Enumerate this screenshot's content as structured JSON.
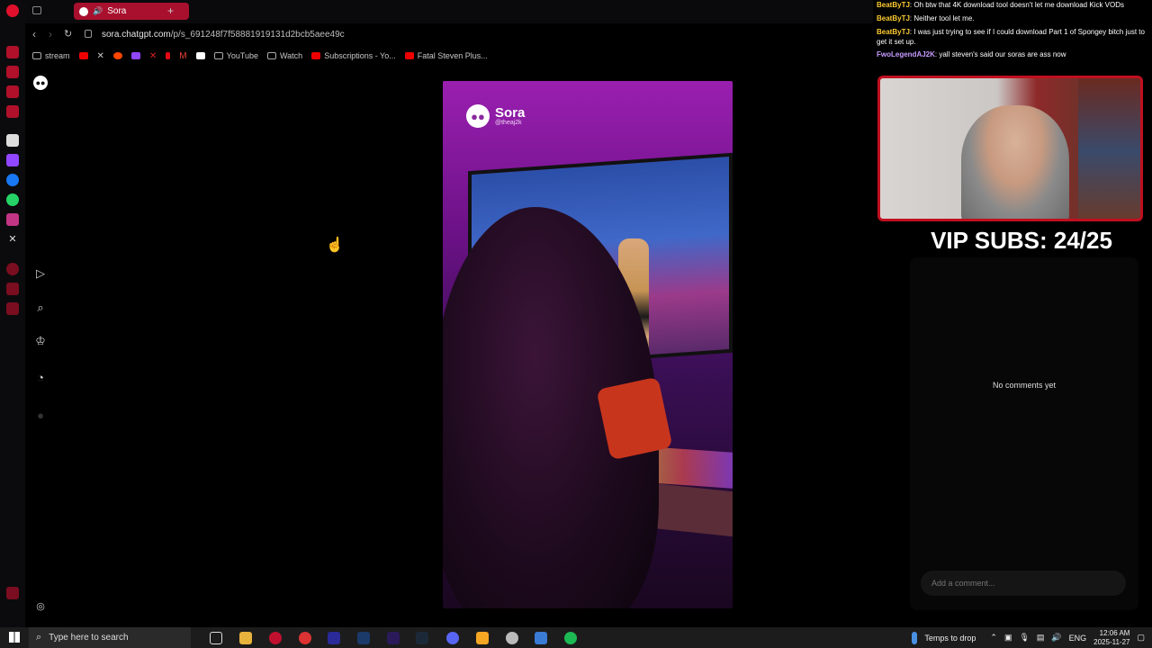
{
  "browser": {
    "tab_title": "Sora",
    "url_domain": "sora.chatgpt.com",
    "url_path": "/p/s_691248f7f58881919131d2bcb5aee49c",
    "bookmarks": [
      "stream",
      "YouTube",
      "Watch",
      "Subscriptions - Yo...",
      "Fatal Steven Plus..."
    ]
  },
  "video": {
    "brand": "Sora",
    "handle": "@theaj2k"
  },
  "comments": {
    "empty_text": "No comments yet",
    "input_placeholder": "Add a comment..."
  },
  "stream_overlay": {
    "chat": [
      {
        "user": "BeatByTJ",
        "text": ": Oh btw that 4K download tool doesn't let me download Kick VODs"
      },
      {
        "user": "BeatByTJ",
        "text": ": Neither tool let me."
      },
      {
        "user": "BeatByTJ",
        "text": ": I was just trying to see if I could download Part 1 of Spongey bitch just to get it set up."
      },
      {
        "user": "FwoLegendAJ2K",
        "text": ": yall steven's said our soras are ass now"
      }
    ],
    "vip_text": "VIP SUBS: 24/25"
  },
  "taskbar": {
    "search_placeholder": "Type here to search",
    "weather_text": "Temps to drop",
    "language": "ENG",
    "time": "12:06 AM",
    "date": "2025-11-27"
  },
  "colors": {
    "accent_tab": "#a8102e",
    "overlay_border": "#c01020"
  }
}
